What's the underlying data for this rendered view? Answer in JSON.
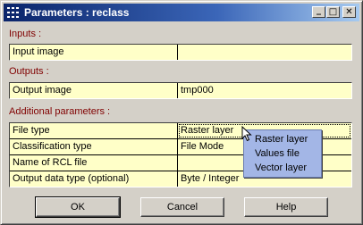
{
  "window": {
    "title": "Parameters : reclass",
    "title_icon": "grid-app-icon",
    "controls": {
      "minimize": "_",
      "maximize": "□",
      "close": "✕"
    }
  },
  "sections": {
    "inputs": "Inputs :",
    "outputs": "Outputs :",
    "additional": "Additional parameters :"
  },
  "inputs": [
    {
      "label": "Input image",
      "value": ""
    }
  ],
  "outputs": [
    {
      "label": "Output image",
      "value": "tmp000"
    }
  ],
  "additional": [
    {
      "label": "File type",
      "value": "Raster layer"
    },
    {
      "label": "Classification type",
      "value": "File Mode"
    },
    {
      "label": "Name of RCL file",
      "value": ""
    },
    {
      "label": "Output data type (optional)",
      "value": "Byte / Integer"
    }
  ],
  "popup_menu": {
    "items": [
      "Raster layer",
      "Values file",
      "Vector layer"
    ]
  },
  "buttons": {
    "ok": "OK",
    "cancel": "Cancel",
    "help": "Help"
  },
  "colors": {
    "title_start": "#0a246a",
    "title_end": "#a6caf0",
    "section_label": "#800000",
    "field_bg": "#ffffc8",
    "popup_bg": "#a3b6e6"
  }
}
